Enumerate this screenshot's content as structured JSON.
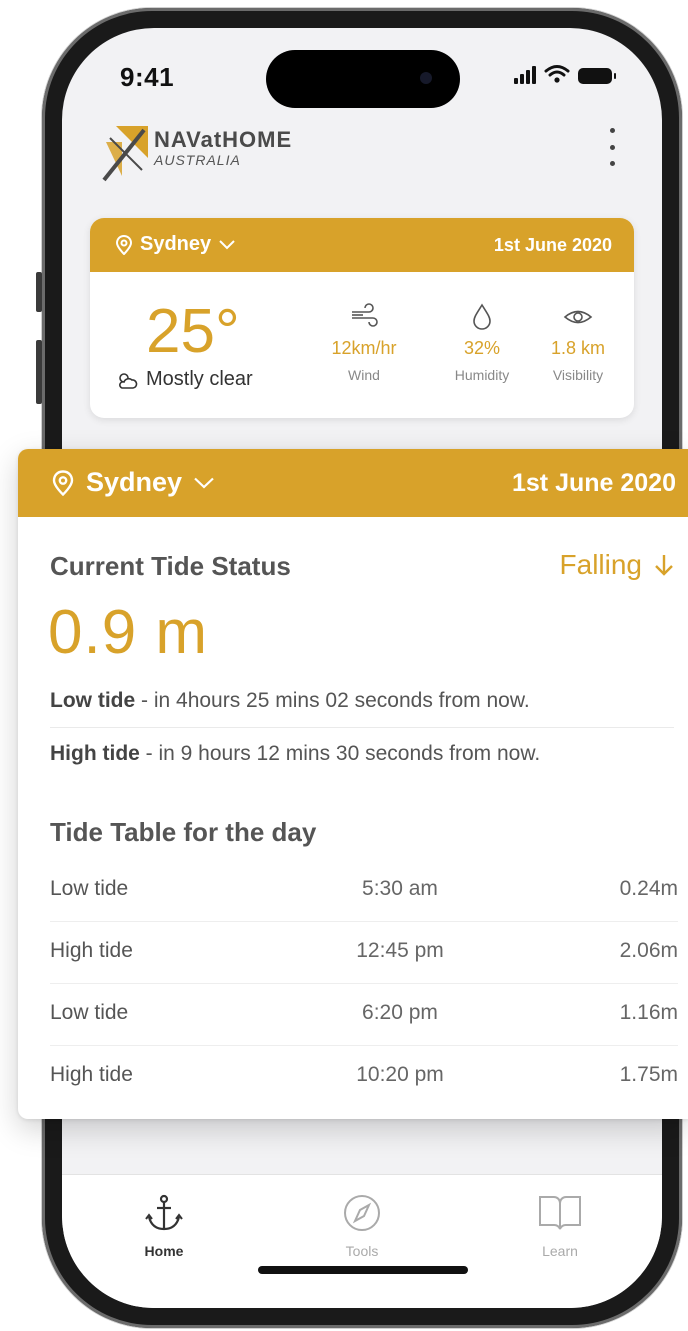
{
  "status_bar": {
    "time": "9:41"
  },
  "app": {
    "brand_name": "NAVatHOME",
    "brand_sub": "AUSTRALIA"
  },
  "weather_card": {
    "city": "Sydney",
    "date": "1st June 2020",
    "temperature": "25°",
    "condition": "Mostly clear",
    "stats": [
      {
        "icon": "wind-icon",
        "value": "12km/hr",
        "label": "Wind"
      },
      {
        "icon": "droplet-icon",
        "value": "32%",
        "label": "Humidity"
      },
      {
        "icon": "eye-icon",
        "value": "1.8 km",
        "label": "Visibility"
      }
    ]
  },
  "tide_card": {
    "city": "Sydney",
    "date": "1st June 2020",
    "status_title": "Current Tide Status",
    "trend": "Falling",
    "height": "0.9 m",
    "low_tide_label": "Low tide",
    "low_tide_text": " - in 4hours 25 mins 02 seconds from now.",
    "high_tide_label": "High tide",
    "high_tide_text": " - in 9 hours 12 mins 30 seconds from now.",
    "table_title": "Tide Table for the day",
    "rows": [
      {
        "type": "Low tide",
        "time": "5:30 am",
        "height": "0.24m"
      },
      {
        "type": "High tide",
        "time": "12:45 pm",
        "height": "2.06m"
      },
      {
        "type": "Low tide",
        "time": "6:20 pm",
        "height": "1.16m"
      },
      {
        "type": "High tide",
        "time": "10:20 pm",
        "height": "1.75m"
      }
    ]
  },
  "tabs": [
    {
      "label": "Home",
      "icon": "anchor-icon",
      "active": true
    },
    {
      "label": "Tools",
      "icon": "compass-icon",
      "active": false
    },
    {
      "label": "Learn",
      "icon": "book-icon",
      "active": false
    }
  ],
  "colors": {
    "accent": "#d8a22a",
    "text": "#555555",
    "muted": "#888888"
  }
}
